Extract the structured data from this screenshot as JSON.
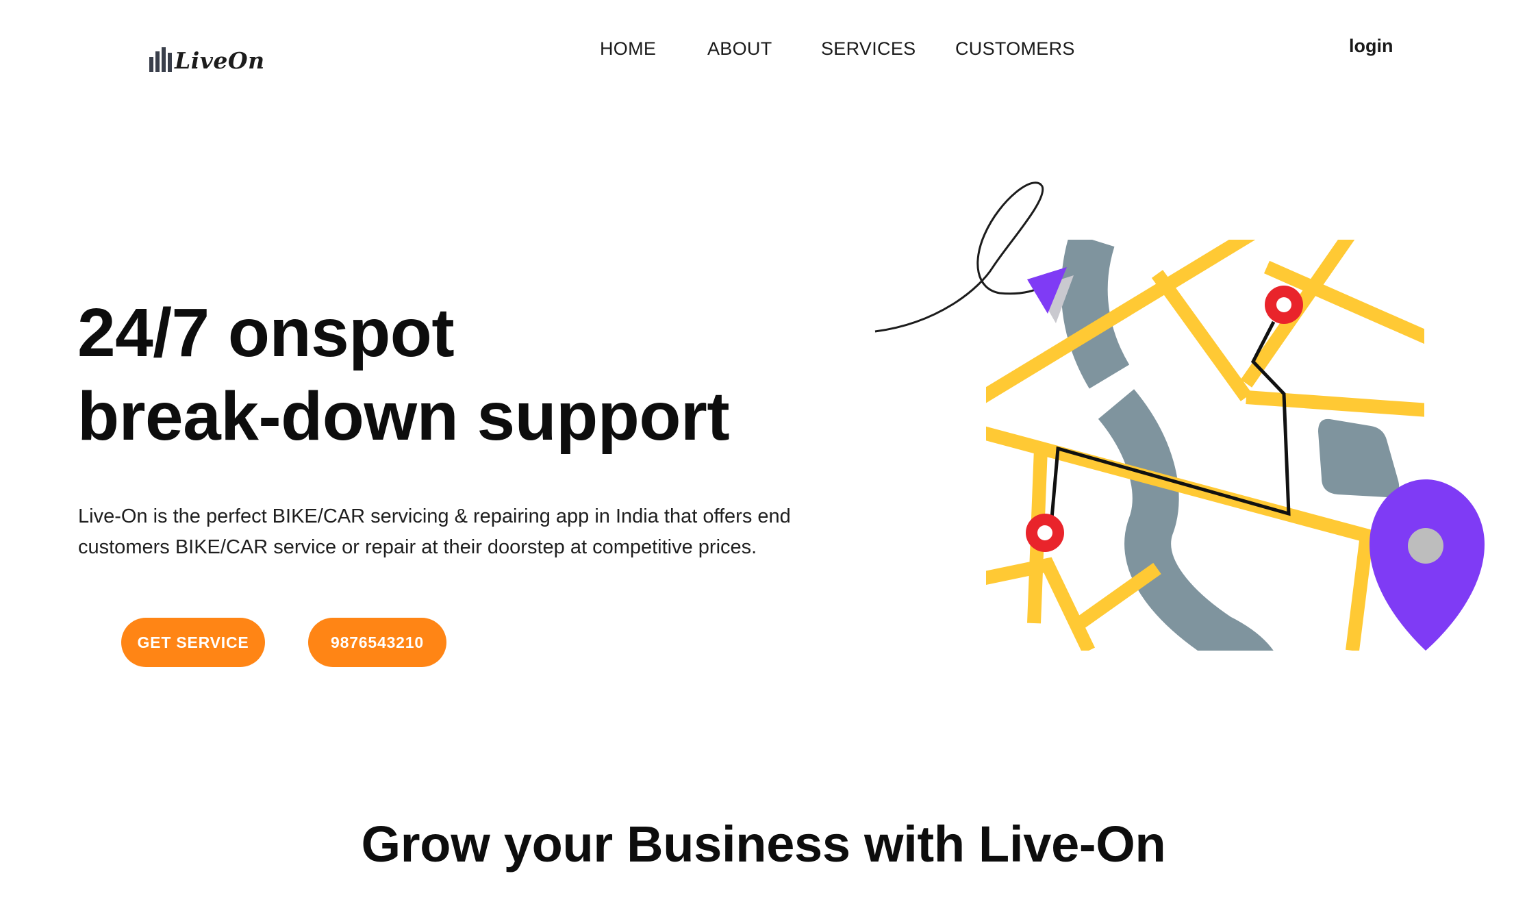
{
  "header": {
    "logo_text": "LiveOn",
    "nav": [
      "HOME",
      "ABOUT",
      "SERVICES",
      "CUSTOMERS"
    ],
    "login_label": "login"
  },
  "hero": {
    "title_line1": "24/7 onspot",
    "title_line2": "break-down support",
    "description": "Live-On is the perfect BIKE/CAR servicing & repairing app in India that offers end customers BIKE/CAR service or repair at their doorstep at competitive prices.",
    "primary_button": "GET SERVICE",
    "phone_button": "9876543210"
  },
  "section": {
    "title": "Grow your Business with Live-On"
  },
  "colors": {
    "accent": "#ff8515",
    "road": "#ffc934",
    "river": "#7f949e",
    "pin_red": "#e9242b",
    "pin_purple": "#7f3bf5"
  },
  "icons": {
    "logo": "bar-chart-logo-icon",
    "illustration": "map-navigation-illustration"
  }
}
